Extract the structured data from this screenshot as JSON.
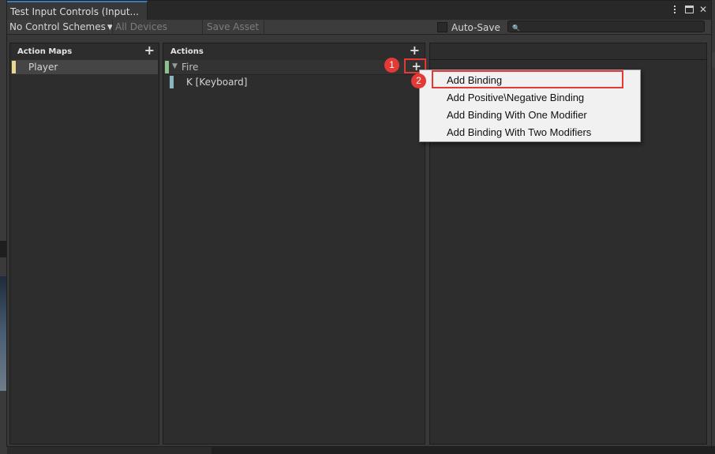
{
  "window": {
    "tab_title": "Test Input Controls (Input..."
  },
  "toolbar": {
    "control_schemes": "No Control Schemes",
    "devices": "All Devices",
    "save_asset": "Save Asset",
    "auto_save": "Auto-Save",
    "search_value": ""
  },
  "action_maps": {
    "title": "Action Maps",
    "items": [
      {
        "label": "Player",
        "color": "#e8d98e"
      }
    ]
  },
  "actions": {
    "title": "Actions",
    "items": [
      {
        "label": "Fire",
        "color": "#8dc18d"
      },
      {
        "label": "K [Keyboard]",
        "color": "#8ab6c0"
      }
    ]
  },
  "menu": {
    "items": [
      "Add Binding",
      "Add Positive\\Negative Binding",
      "Add Binding With One Modifier",
      "Add Binding With Two Modifiers"
    ]
  },
  "annotations": {
    "badge_1": "1",
    "badge_2": "2",
    "highlight_color": "#e53935"
  },
  "icons": {
    "window_menu": "kebab-icon",
    "maximize": "maximize-icon",
    "close": "close-icon",
    "search": "search-icon",
    "add": "plus-icon",
    "foldout": "triangle-down-icon"
  }
}
